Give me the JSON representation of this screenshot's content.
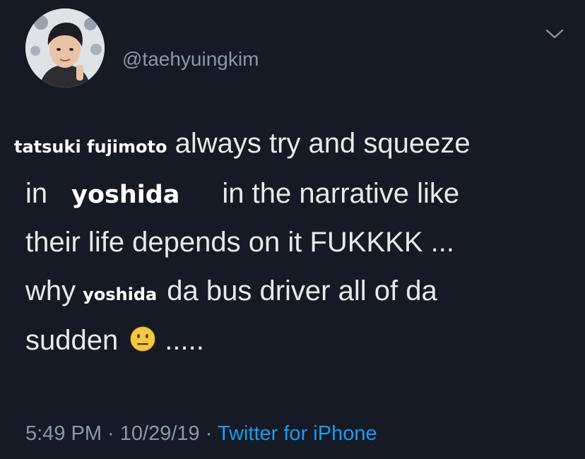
{
  "tweet": {
    "handle": "@taehyuingkim",
    "line1_name": "tatsuki fujimoto",
    "line1_text": " always try and squeeze",
    "line2_pre": "in",
    "line2_name": "yoshida",
    "line2_post": "in the narrative like",
    "line3": "their life depends on it FUKKKK ...",
    "line4_pre": "why",
    "line4_name": "yoshida",
    "line4_post": "da bus driver all of da",
    "line5_pre": "sudden",
    "line5_post": ".....",
    "emoji_icon": "neutral-face-icon"
  },
  "meta": {
    "time": "5:49 PM",
    "separator": " · ",
    "date": "10/29/19",
    "source": "Twitter for iPhone"
  },
  "colors": {
    "background": "#161a24",
    "text": "#e7e9ea",
    "secondary": "#8b98a5",
    "link": "#1d9bf0"
  }
}
